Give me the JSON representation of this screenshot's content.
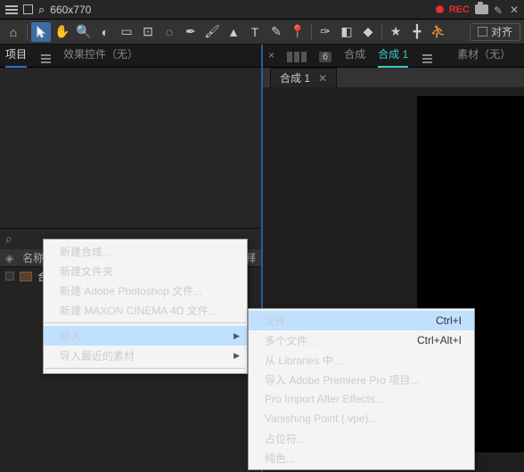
{
  "topbar": {
    "dimensions": "660x770",
    "rec_label": "REC",
    "close": "✕"
  },
  "toolbar": {
    "align_label": "对齐",
    "tools": [
      "home",
      "pointer",
      "hand",
      "zoom",
      "orbit",
      "rect",
      "roundrect",
      "dashrect",
      "pen",
      "brush",
      "stamp",
      "text",
      "feather",
      "pin",
      "nib",
      "eraser",
      "color",
      "star",
      "axis",
      "person"
    ]
  },
  "left_panel": {
    "tabs": {
      "project": "项目",
      "effects": "效果控件（无）"
    },
    "search_placeholder": "",
    "list_header": {
      "name": "名称",
      "comment": "注释"
    },
    "items": [
      {
        "label": "合成 1"
      }
    ]
  },
  "right_panel": {
    "header": {
      "compose_label": "合成",
      "active_comp": "合成 1",
      "num": "6",
      "source": "素材（无）"
    },
    "tab": {
      "label": "合成 1",
      "close": "✕"
    }
  },
  "context_menu_1": {
    "new_comp": "新建合成...",
    "new_folder": "新建文件夹",
    "new_ps": "新建 Adobe Photoshop 文件...",
    "new_c4d": "新建 MAXON CINEMA 4D 文件...",
    "import": "导入",
    "import_recent": "导入最近的素材"
  },
  "context_menu_2": {
    "file": "文件...",
    "file_sc": "Ctrl+I",
    "multi": "多个文件...",
    "multi_sc": "Ctrl+Alt+I",
    "from_lib": "从 Libraries 中...",
    "import_pp": "导入 Adobe Premiere Pro 项目...",
    "pro_import": "Pro Import After Effects...",
    "vanishing": "Vanishing Point (.vpe)...",
    "placeholder": "占位符...",
    "solid": "纯色..."
  }
}
